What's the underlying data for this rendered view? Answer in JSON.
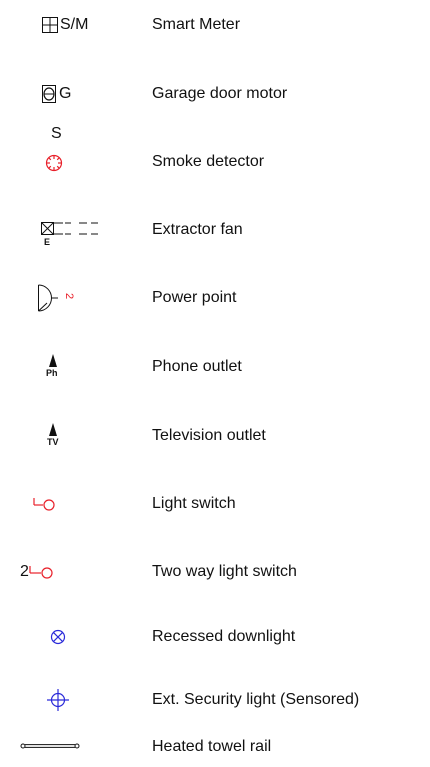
{
  "colors": {
    "black": "#111111",
    "red": "#e8202a",
    "blue": "#2b2bd9"
  },
  "legend": {
    "rows": [
      {
        "icon": "smart-meter-icon",
        "symbol_text": "S/M",
        "label": "Smart Meter"
      },
      {
        "icon": "garage-door-motor-icon",
        "symbol_text": "G",
        "label": "Garage door motor"
      },
      {
        "icon": "smoke-detector-icon",
        "symbol_text": "S",
        "label": "Smoke detector"
      },
      {
        "icon": "extractor-fan-icon",
        "symbol_text": "E",
        "label": "Extractor fan"
      },
      {
        "icon": "power-point-icon",
        "symbol_text": "2",
        "label": "Power point"
      },
      {
        "icon": "phone-outlet-icon",
        "symbol_text": "Ph",
        "label": "Phone outlet"
      },
      {
        "icon": "television-outlet-icon",
        "symbol_text": "TV",
        "label": "Television outlet"
      },
      {
        "icon": "light-switch-icon",
        "symbol_text": "",
        "label": "Light switch"
      },
      {
        "icon": "two-way-light-switch-icon",
        "symbol_text": "2",
        "label": "Two way light switch"
      },
      {
        "icon": "recessed-downlight-icon",
        "symbol_text": "",
        "label": "Recessed downlight"
      },
      {
        "icon": "security-light-icon",
        "symbol_text": "",
        "label": "Ext. Security light (Sensored)"
      },
      {
        "icon": "towel-rail-icon",
        "symbol_text": "",
        "label": "Heated towel rail"
      }
    ]
  }
}
